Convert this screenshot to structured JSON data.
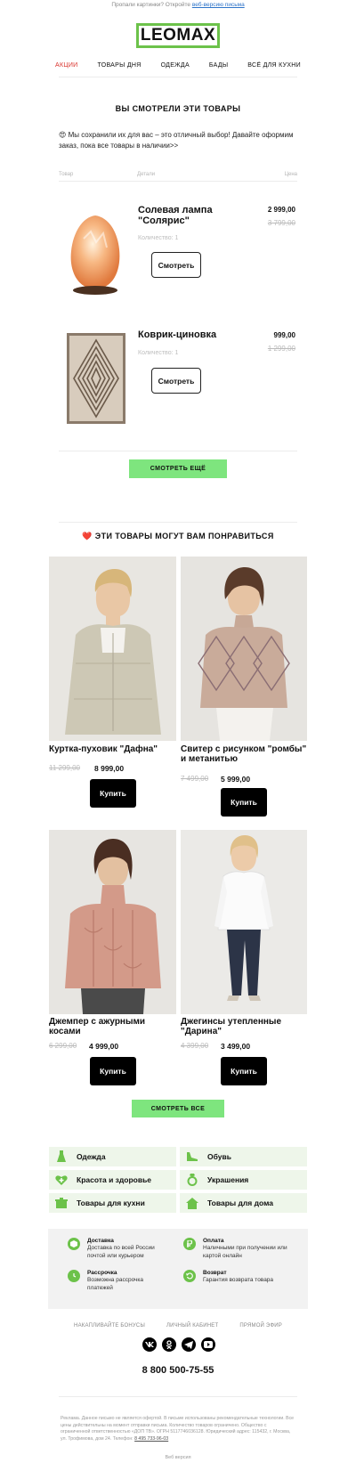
{
  "preheader": {
    "text": "Пропали картинки? Откройте",
    "link": "веб-версию письма"
  },
  "logo": {
    "text": "LEOMAX"
  },
  "nav": [
    {
      "label": "АКЦИИ"
    },
    {
      "label": "ТОВАРЫ ДНЯ"
    },
    {
      "label": "ОДЕЖДА"
    },
    {
      "label": "БАДЫ"
    },
    {
      "label": "ВСЁ ДЛЯ КУХНИ"
    }
  ],
  "viewed": {
    "title": "ВЫ СМОТРЕЛИ ЭТИ ТОВАРЫ",
    "intro": "😍 Мы сохранили их для вас – это отличный выбор! Давайте оформим заказ, пока все товары в наличии>>",
    "columns": {
      "product": "Товар",
      "details": "Детали",
      "price": "Цена"
    },
    "items": [
      {
        "name": "Солевая лампа \"Солярис\"",
        "qty": "Количество: 1",
        "price": "2 999,00",
        "old_price": "3 799,00",
        "button": "Смотреть"
      },
      {
        "name": "Коврик-циновка",
        "qty": "Количество: 1",
        "price": "999,00",
        "old_price": "1 299,00",
        "button": "Смотреть"
      }
    ],
    "more_button": "СМОТРЕТЬ ЕЩЁ"
  },
  "recommend": {
    "title": "❤️ ЭТИ ТОВАРЫ МОГУТ ВАМ ПОНРАВИТЬСЯ",
    "items": [
      {
        "name": "Куртка-пуховик \"Дафна\"",
        "old_price": "11 299,00",
        "price": "8 999,00",
        "button": "Купить"
      },
      {
        "name": "Свитер с рисунком \"ромбы\" и метанитью",
        "old_price": "7 499,00",
        "price": "5 999,00",
        "button": "Купить"
      },
      {
        "name": "Джемпер с ажурными косами",
        "old_price": "6 299,00",
        "price": "4 999,00",
        "button": "Купить"
      },
      {
        "name": "Джегинсы утепленные \"Дарина\"",
        "old_price": "4 399,00",
        "price": "3 499,00",
        "button": "Купить"
      }
    ],
    "all_button": "СМОТРЕТЬ ВСЕ"
  },
  "categories": [
    {
      "label": "Одежда",
      "icon": "dress-icon"
    },
    {
      "label": "Обувь",
      "icon": "shoe-icon"
    },
    {
      "label": "Красота и здоровье",
      "icon": "heart-plus-icon"
    },
    {
      "label": "Украшения",
      "icon": "ring-icon"
    },
    {
      "label": "Товары для кухни",
      "icon": "pot-icon"
    },
    {
      "label": "Товары для дома",
      "icon": "house-icon"
    }
  ],
  "info": [
    {
      "title": "Доставка",
      "text": "Доставка по всей России почтой или курьером",
      "icon": "box-icon"
    },
    {
      "title": "Оплата",
      "text": "Наличными при получении или картой онлайн",
      "icon": "ruble-icon"
    },
    {
      "title": "Рассрочка",
      "text": "Возможна рассрочка платежей",
      "icon": "clock-icon"
    },
    {
      "title": "Возврат",
      "text": "Гарантия возврата товара",
      "icon": "return-icon"
    }
  ],
  "footer": {
    "links": [
      "НАКАПЛИВАЙТЕ БОНУСЫ",
      "ЛИЧНЫЙ КАБИНЕТ",
      "ПРЯМОЙ ЭФИР"
    ],
    "social": [
      "vk-icon",
      "ok-icon",
      "telegram-icon",
      "youtube-icon"
    ],
    "phone": "8 800 500-75-55",
    "legal": "Реклама. Данное письмо не является офертой. В письме использованы рекомендательные технологии. Все цены действительны на момент отправки письма. Количество товаров ограничено. Общество с ограниченной ответственностью «ДОП ТВ». ОГРН 5117746036128. Юридический адрес: 115432, г. Москва, ул. Трофимова, дом 24. Телефон:",
    "legal_phone": "8 495 733-96-03",
    "web_version": "Веб версия"
  },
  "colors": {
    "accent_green": "#7ee57e",
    "logo_green": "#6cc24a",
    "active_red": "#d9302a",
    "category_bg": "#eef6ea"
  }
}
